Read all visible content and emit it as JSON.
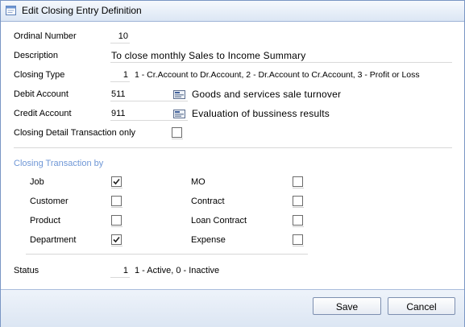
{
  "window": {
    "title": "Edit Closing Entry Definition"
  },
  "form": {
    "ordinal_number": {
      "label": "Ordinal Number",
      "value": "10"
    },
    "description": {
      "label": "Description",
      "value": "To close monthly Sales to Income Summary"
    },
    "closing_type": {
      "label": "Closing Type",
      "value": "1",
      "hint": "1 - Cr.Account to Dr.Account, 2 - Dr.Account to Cr.Account, 3 - Profit or Loss"
    },
    "debit_account": {
      "label": "Debit Account",
      "code": "511",
      "name": "Goods and services sale turnover"
    },
    "credit_account": {
      "label": "Credit Account",
      "code": "911",
      "name": "Evaluation of bussiness results"
    },
    "closing_detail_only": {
      "label": "Closing Detail Transaction only",
      "checked": false
    }
  },
  "closing_by": {
    "title": "Closing Transaction by",
    "left": [
      {
        "label": "Job",
        "checked": true
      },
      {
        "label": "Customer",
        "checked": false
      },
      {
        "label": "Product",
        "checked": false
      },
      {
        "label": "Department",
        "checked": true
      }
    ],
    "right": [
      {
        "label": "MO",
        "checked": false
      },
      {
        "label": "Contract",
        "checked": false
      },
      {
        "label": "Loan Contract",
        "checked": false
      },
      {
        "label": "Expense",
        "checked": false
      }
    ]
  },
  "status": {
    "label": "Status",
    "value": "1",
    "hint": "1 - Active, 0 - Inactive"
  },
  "buttons": {
    "save": "Save",
    "cancel": "Cancel"
  },
  "colors": {
    "section_title": "#6f97d6",
    "border": "#7a96c4"
  }
}
